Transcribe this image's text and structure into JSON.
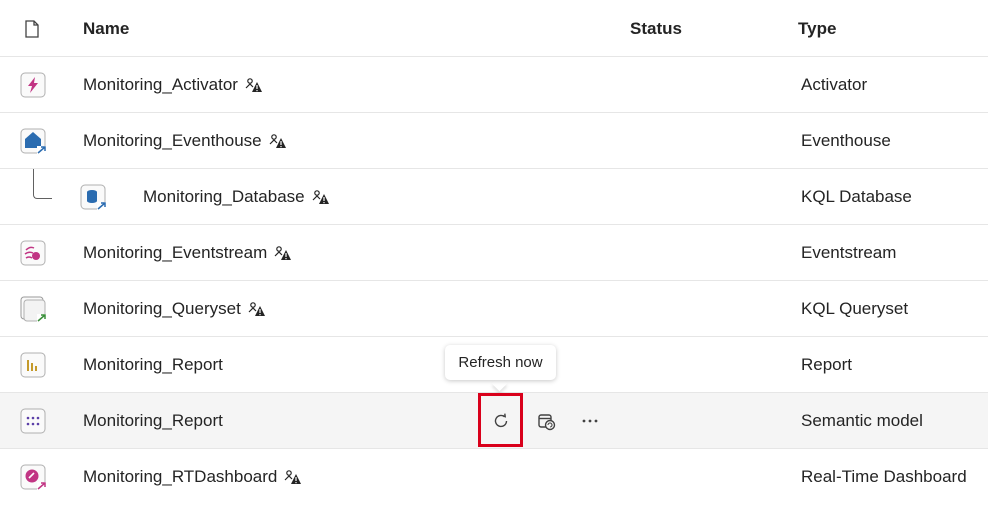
{
  "header": {
    "name": "Name",
    "status": "Status",
    "type": "Type"
  },
  "rows": [
    {
      "name": "Monitoring_Activator",
      "type": "Activator"
    },
    {
      "name": "Monitoring_Eventhouse",
      "type": "Eventhouse"
    },
    {
      "name": "Monitoring_Database",
      "type": "KQL Database"
    },
    {
      "name": "Monitoring_Eventstream",
      "type": "Eventstream"
    },
    {
      "name": "Monitoring_Queryset",
      "type": "KQL Queryset"
    },
    {
      "name": "Monitoring_Report",
      "type": "Report"
    },
    {
      "name": "Monitoring_Report",
      "type": "Semantic model"
    },
    {
      "name": "Monitoring_RTDashboard",
      "type": "Real-Time Dashboard"
    }
  ],
  "tooltip": {
    "text": "Refresh now"
  },
  "colors": {
    "highlight": "#d9001b",
    "activator": "#c13584",
    "eventhouse": "#2b6cb0",
    "report": "#c49a2b"
  }
}
